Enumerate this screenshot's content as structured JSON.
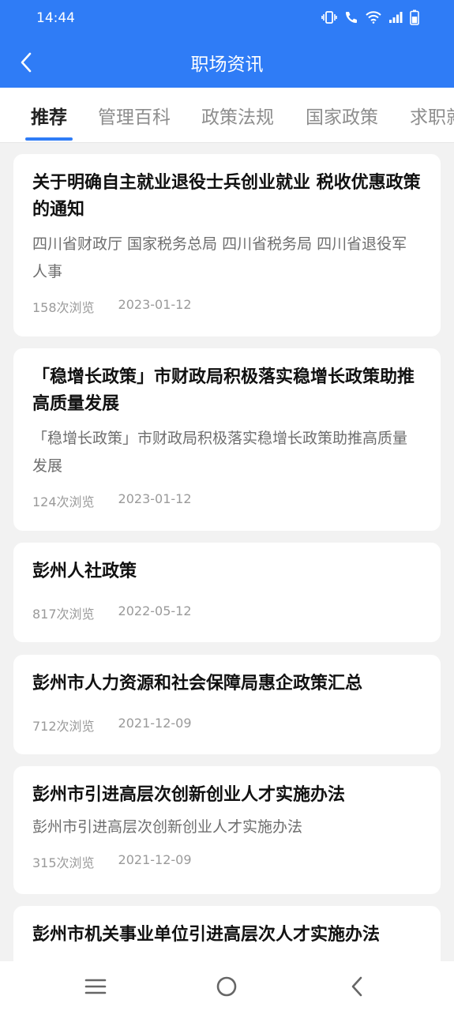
{
  "status_bar": {
    "time": "14:44"
  },
  "header": {
    "title": "职场资讯"
  },
  "tabs": [
    {
      "label": "推荐",
      "active": true
    },
    {
      "label": "管理百科",
      "active": false
    },
    {
      "label": "政策法规",
      "active": false
    },
    {
      "label": "国家政策",
      "active": false
    },
    {
      "label": "求职就",
      "active": false
    }
  ],
  "articles": [
    {
      "title": "关于明确自主就业退役士兵创业就业 税收优惠政策的通知",
      "summary": "四川省财政厅 国家税务总局 四川省税务局 四川省退役军人事",
      "views": "158次浏览",
      "date": "2023-01-12"
    },
    {
      "title": "「稳增长政策」市财政局积极落实稳增长政策助推高质量发展",
      "summary": "「稳增长政策」市财政局积极落实稳增长政策助推高质量发展",
      "views": "124次浏览",
      "date": "2023-01-12"
    },
    {
      "title": "彭州人社政策",
      "summary": "",
      "views": "817次浏览",
      "date": "2022-05-12"
    },
    {
      "title": "彭州市人力资源和社会保障局惠企政策汇总",
      "summary": "",
      "views": "712次浏览",
      "date": "2021-12-09"
    },
    {
      "title": "彭州市引进高层次创新创业人才实施办法",
      "summary": "彭州市引进高层次创新创业人才实施办法",
      "views": "315次浏览",
      "date": "2021-12-09"
    },
    {
      "title": "彭州市机关事业单位引进高层次人才实施办法",
      "summary": "",
      "views": "",
      "date": ""
    }
  ],
  "colors": {
    "accent": "#2f7cf6",
    "background": "#f2f2f2"
  }
}
